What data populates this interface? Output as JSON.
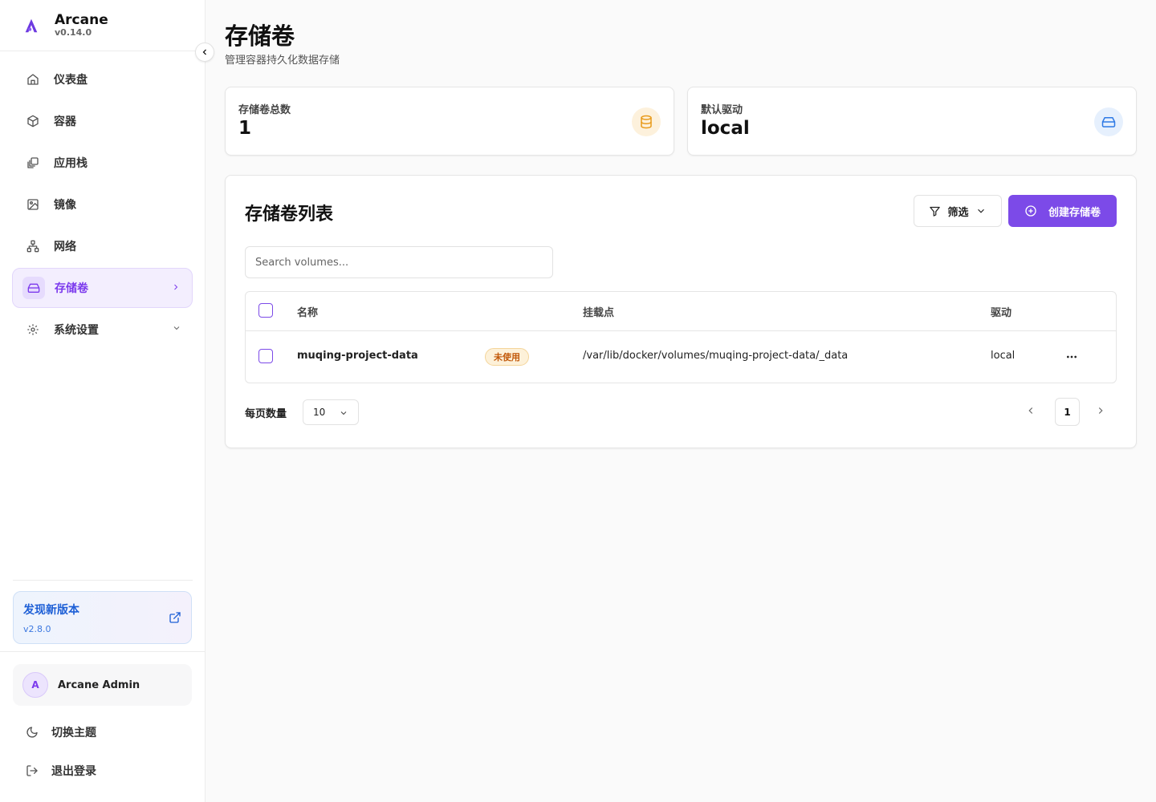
{
  "brand": {
    "name": "Arcane",
    "version": "v0.14.0"
  },
  "nav": {
    "items": [
      {
        "label": "仪表盘",
        "icon": "home-icon"
      },
      {
        "label": "容器",
        "icon": "box-icon"
      },
      {
        "label": "应用栈",
        "icon": "layers-icon"
      },
      {
        "label": "镜像",
        "icon": "image-icon"
      },
      {
        "label": "网络",
        "icon": "network-icon"
      },
      {
        "label": "存储卷",
        "icon": "hard-drive-icon",
        "active": true
      },
      {
        "label": "系统设置",
        "icon": "gear-icon"
      }
    ]
  },
  "update": {
    "title": "发现新版本",
    "version": "v2.8.0"
  },
  "user": {
    "initial": "A",
    "name": "Arcane Admin"
  },
  "bottom": {
    "theme_label": "切换主题",
    "logout_label": "退出登录"
  },
  "page": {
    "title": "存储卷",
    "subtitle": "管理容器持久化数据存储"
  },
  "stats": {
    "total_label": "存储卷总数",
    "total_value": "1",
    "driver_label": "默认驱动",
    "driver_value": "local"
  },
  "list": {
    "title": "存储卷列表",
    "filter_label": "筛选",
    "create_label": "创建存储卷",
    "search_placeholder": "Search volumes...",
    "columns": {
      "name": "名称",
      "mountpoint": "挂载点",
      "driver": "驱动"
    },
    "rows": [
      {
        "name": "muqing-project-data",
        "badge": "未使用",
        "mountpoint": "/var/lib/docker/volumes/muqing-project-data/_data",
        "driver": "local"
      }
    ]
  },
  "pagination": {
    "per_page_label": "每页数量",
    "per_page": "10",
    "current_page": "1"
  },
  "colors": {
    "accent": "#7c4ae8",
    "badge_bg": "#fdf1d9",
    "badge_text": "#c2590a",
    "update_text": "#1d5fd6"
  }
}
